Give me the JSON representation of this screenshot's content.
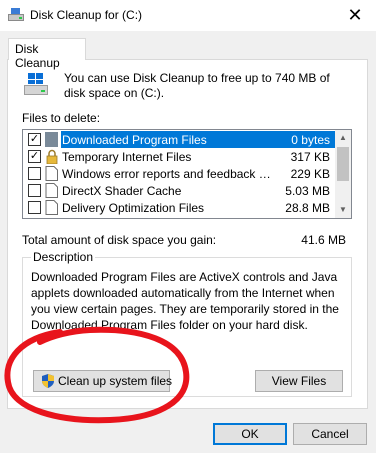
{
  "window": {
    "title": "Disk Cleanup for  (C:)",
    "close_glyph": "✕"
  },
  "tab": {
    "label": "Disk Cleanup"
  },
  "header": {
    "text": "You can use Disk Cleanup to free up to 740 MB of disk space on  (C:)."
  },
  "files": {
    "label": "Files to delete:",
    "items": [
      {
        "name": "Downloaded Program Files",
        "size": "0 bytes",
        "checked": true,
        "selected": true,
        "icon": "folder-icon"
      },
      {
        "name": "Temporary Internet Files",
        "size": "317 KB",
        "checked": true,
        "selected": false,
        "icon": "lock-icon"
      },
      {
        "name": "Windows error reports and feedback di...",
        "size": "229 KB",
        "checked": false,
        "selected": false,
        "icon": "document-icon"
      },
      {
        "name": "DirectX Shader Cache",
        "size": "5.03 MB",
        "checked": false,
        "selected": false,
        "icon": "document-icon"
      },
      {
        "name": "Delivery Optimization Files",
        "size": "28.8 MB",
        "checked": false,
        "selected": false,
        "icon": "document-icon"
      }
    ],
    "check_glyph": "✓",
    "scroll_up_glyph": "▲",
    "scroll_down_glyph": "▼"
  },
  "total": {
    "label": "Total amount of disk space you gain:",
    "value": "41.6 MB"
  },
  "description": {
    "legend": "Description",
    "text": "Downloaded Program Files are ActiveX controls and Java applets downloaded automatically from the Internet when you view certain pages. They are temporarily stored in the Downloaded Program Files folder on your hard disk."
  },
  "buttons": {
    "cleanup": "Clean up system files",
    "view": "View Files",
    "ok": "OK",
    "cancel": "Cancel"
  },
  "colors": {
    "selection": "#0078d7",
    "annotation": "#e8141c"
  }
}
